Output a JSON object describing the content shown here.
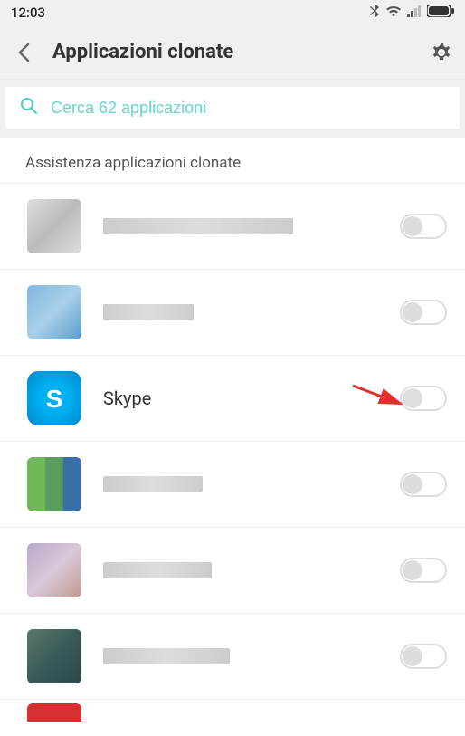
{
  "statusBar": {
    "time": "12:03"
  },
  "header": {
    "title": "Applicazioni clonate"
  },
  "search": {
    "placeholder": "Cerca 62 applicazioni"
  },
  "sectionTitle": "Assistenza applicazioni clonate",
  "apps": [
    {
      "name": "",
      "toggled": false,
      "blurred": true
    },
    {
      "name": "",
      "toggled": false,
      "blurred": true
    },
    {
      "name": "Skype",
      "toggled": false,
      "blurred": false
    },
    {
      "name": "",
      "toggled": false,
      "blurred": true
    },
    {
      "name": "",
      "toggled": false,
      "blurred": true
    },
    {
      "name": "",
      "toggled": false,
      "blurred": true
    }
  ]
}
